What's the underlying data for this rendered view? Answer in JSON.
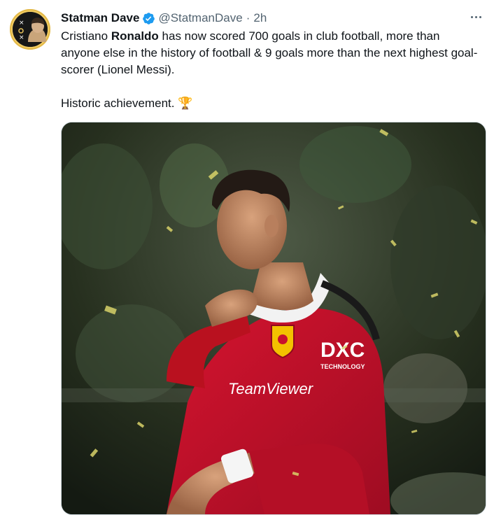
{
  "tweet": {
    "author": {
      "name": "Statman Dave",
      "handle": "@StatmanDave",
      "verified": true,
      "avatar_icon": "avatar-image"
    },
    "separator": "·",
    "time": "2h",
    "more_icon": "more-options-icon",
    "text": {
      "line1_before": "Cristiano ",
      "line1_bold": "Ronaldo",
      "line1_after": " has now scored 700 goals in club football, more than anyone else in the history of football & 9 goals more than the next highest goal-scorer (Lionel Messi).",
      "line2": "Historic achievement.",
      "emoji": "🏆"
    },
    "media": {
      "kind": "photo",
      "jersey_sponsor": "TeamViewer",
      "sleeve_sponsor": "DXC",
      "sleeve_sponsor_sub": "TECHNOLOGY"
    }
  },
  "colors": {
    "verified_blue": "#1d9bf0",
    "text_primary": "#0f1419",
    "text_secondary": "#536471",
    "jersey_red": "#c8102e"
  }
}
